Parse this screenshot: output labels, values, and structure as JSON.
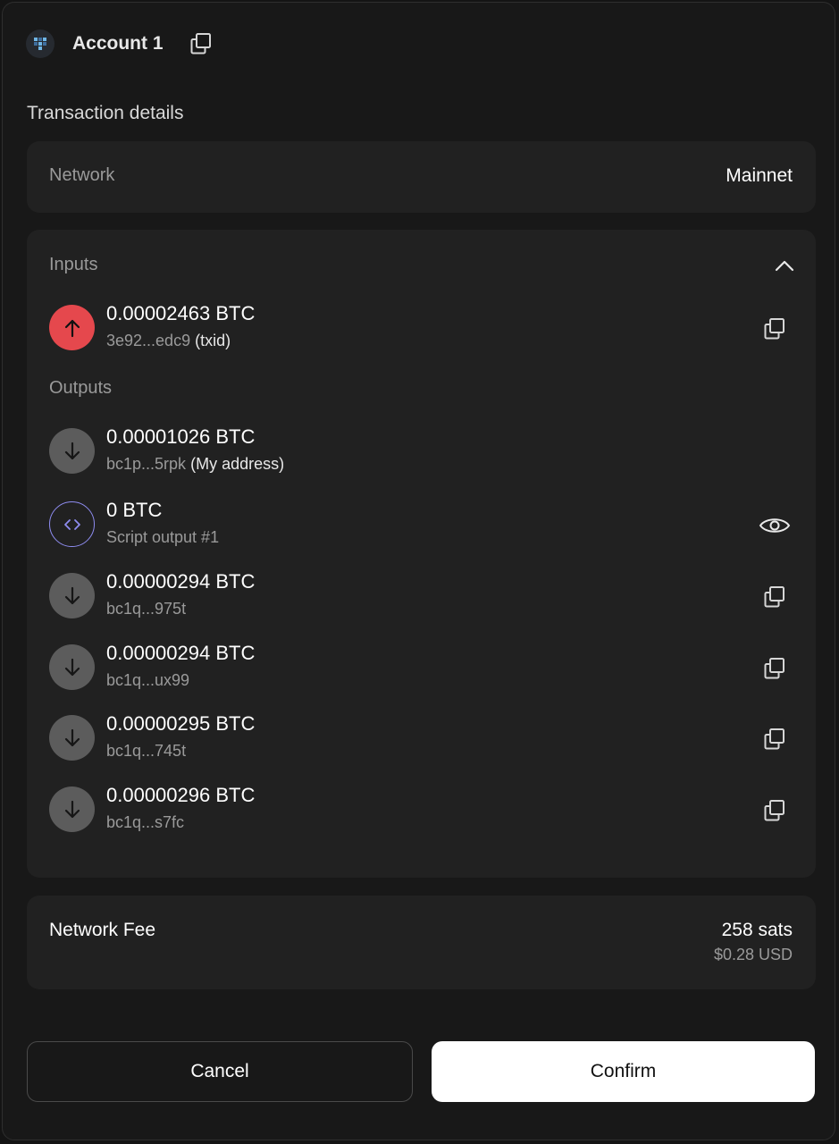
{
  "header": {
    "account_name": "Account 1"
  },
  "section_title": "Transaction details",
  "network": {
    "label": "Network",
    "value": "Mainnet"
  },
  "inputs": {
    "label": "Inputs",
    "items": [
      {
        "amount": "0.00002463 BTC",
        "address": "3e92...edc9",
        "tag": "(txid)",
        "icon": "arrow-up-icon"
      }
    ]
  },
  "outputs": {
    "label": "Outputs",
    "items": [
      {
        "amount": "0.00001026 BTC",
        "address": "bc1p...5rpk",
        "tag": "(My address)",
        "icon": "arrow-down-icon"
      },
      {
        "amount": "0 BTC",
        "address": "Script output #1",
        "tag": "",
        "icon": "code-icon",
        "action": "eye-icon"
      },
      {
        "amount": "0.00000294 BTC",
        "address": "bc1q...975t",
        "tag": "",
        "icon": "arrow-down-icon",
        "action": "copy-icon"
      },
      {
        "amount": "0.00000294 BTC",
        "address": "bc1q...ux99",
        "tag": "",
        "icon": "arrow-down-icon",
        "action": "copy-icon"
      },
      {
        "amount": "0.00000295 BTC",
        "address": "bc1q...745t",
        "tag": "",
        "icon": "arrow-down-icon",
        "action": "copy-icon"
      },
      {
        "amount": "0.00000296 BTC",
        "address": "bc1q...s7fc",
        "tag": "",
        "icon": "arrow-down-icon",
        "action": "copy-icon"
      }
    ]
  },
  "fee": {
    "label": "Network Fee",
    "sats": "258 sats",
    "usd": "$0.28 USD"
  },
  "buttons": {
    "cancel": "Cancel",
    "confirm": "Confirm"
  },
  "colors": {
    "input_icon": "#e5484d",
    "output_icon": "#5c5c5c",
    "script_icon": "#8e8cf0",
    "confirm_bg": "#ffffff"
  }
}
